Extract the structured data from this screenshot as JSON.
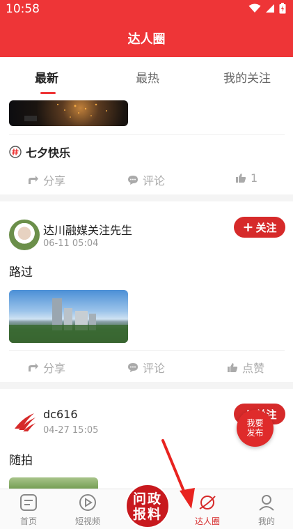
{
  "status_bar": {
    "time": "10:58"
  },
  "header": {
    "title": "达人圈"
  },
  "tabs": [
    {
      "label": "最新",
      "active": true
    },
    {
      "label": "最热",
      "active": false
    },
    {
      "label": "我的关注",
      "active": false
    }
  ],
  "posts": [
    {
      "topic": "七夕快乐",
      "actions": {
        "share": "分享",
        "comment": "评论",
        "like": "1"
      }
    },
    {
      "author": "达川融媒关注先生",
      "time": "06-11 05:04",
      "follow_label": "关注",
      "text": "路过",
      "actions": {
        "share": "分享",
        "comment": "评论",
        "like": "点赞"
      }
    },
    {
      "author": "dc616",
      "time": "04-27 15:05",
      "follow_label": "关注",
      "text": "随拍"
    }
  ],
  "float_button": {
    "line1": "我要",
    "line2": "发布"
  },
  "bottom_nav": [
    {
      "label": "首页",
      "icon": "home-doc-icon"
    },
    {
      "label": "短视频",
      "icon": "play-circle-icon"
    },
    {
      "label": "达人圈",
      "icon": "planet-icon",
      "active": true
    },
    {
      "label": "我的",
      "icon": "person-icon"
    }
  ],
  "center_button": {
    "line1": "问政",
    "line2": "报料"
  },
  "colors": {
    "brand_red": "#ee3537",
    "follow_red": "#d62a2a",
    "text_gray": "#aaaaaa"
  }
}
